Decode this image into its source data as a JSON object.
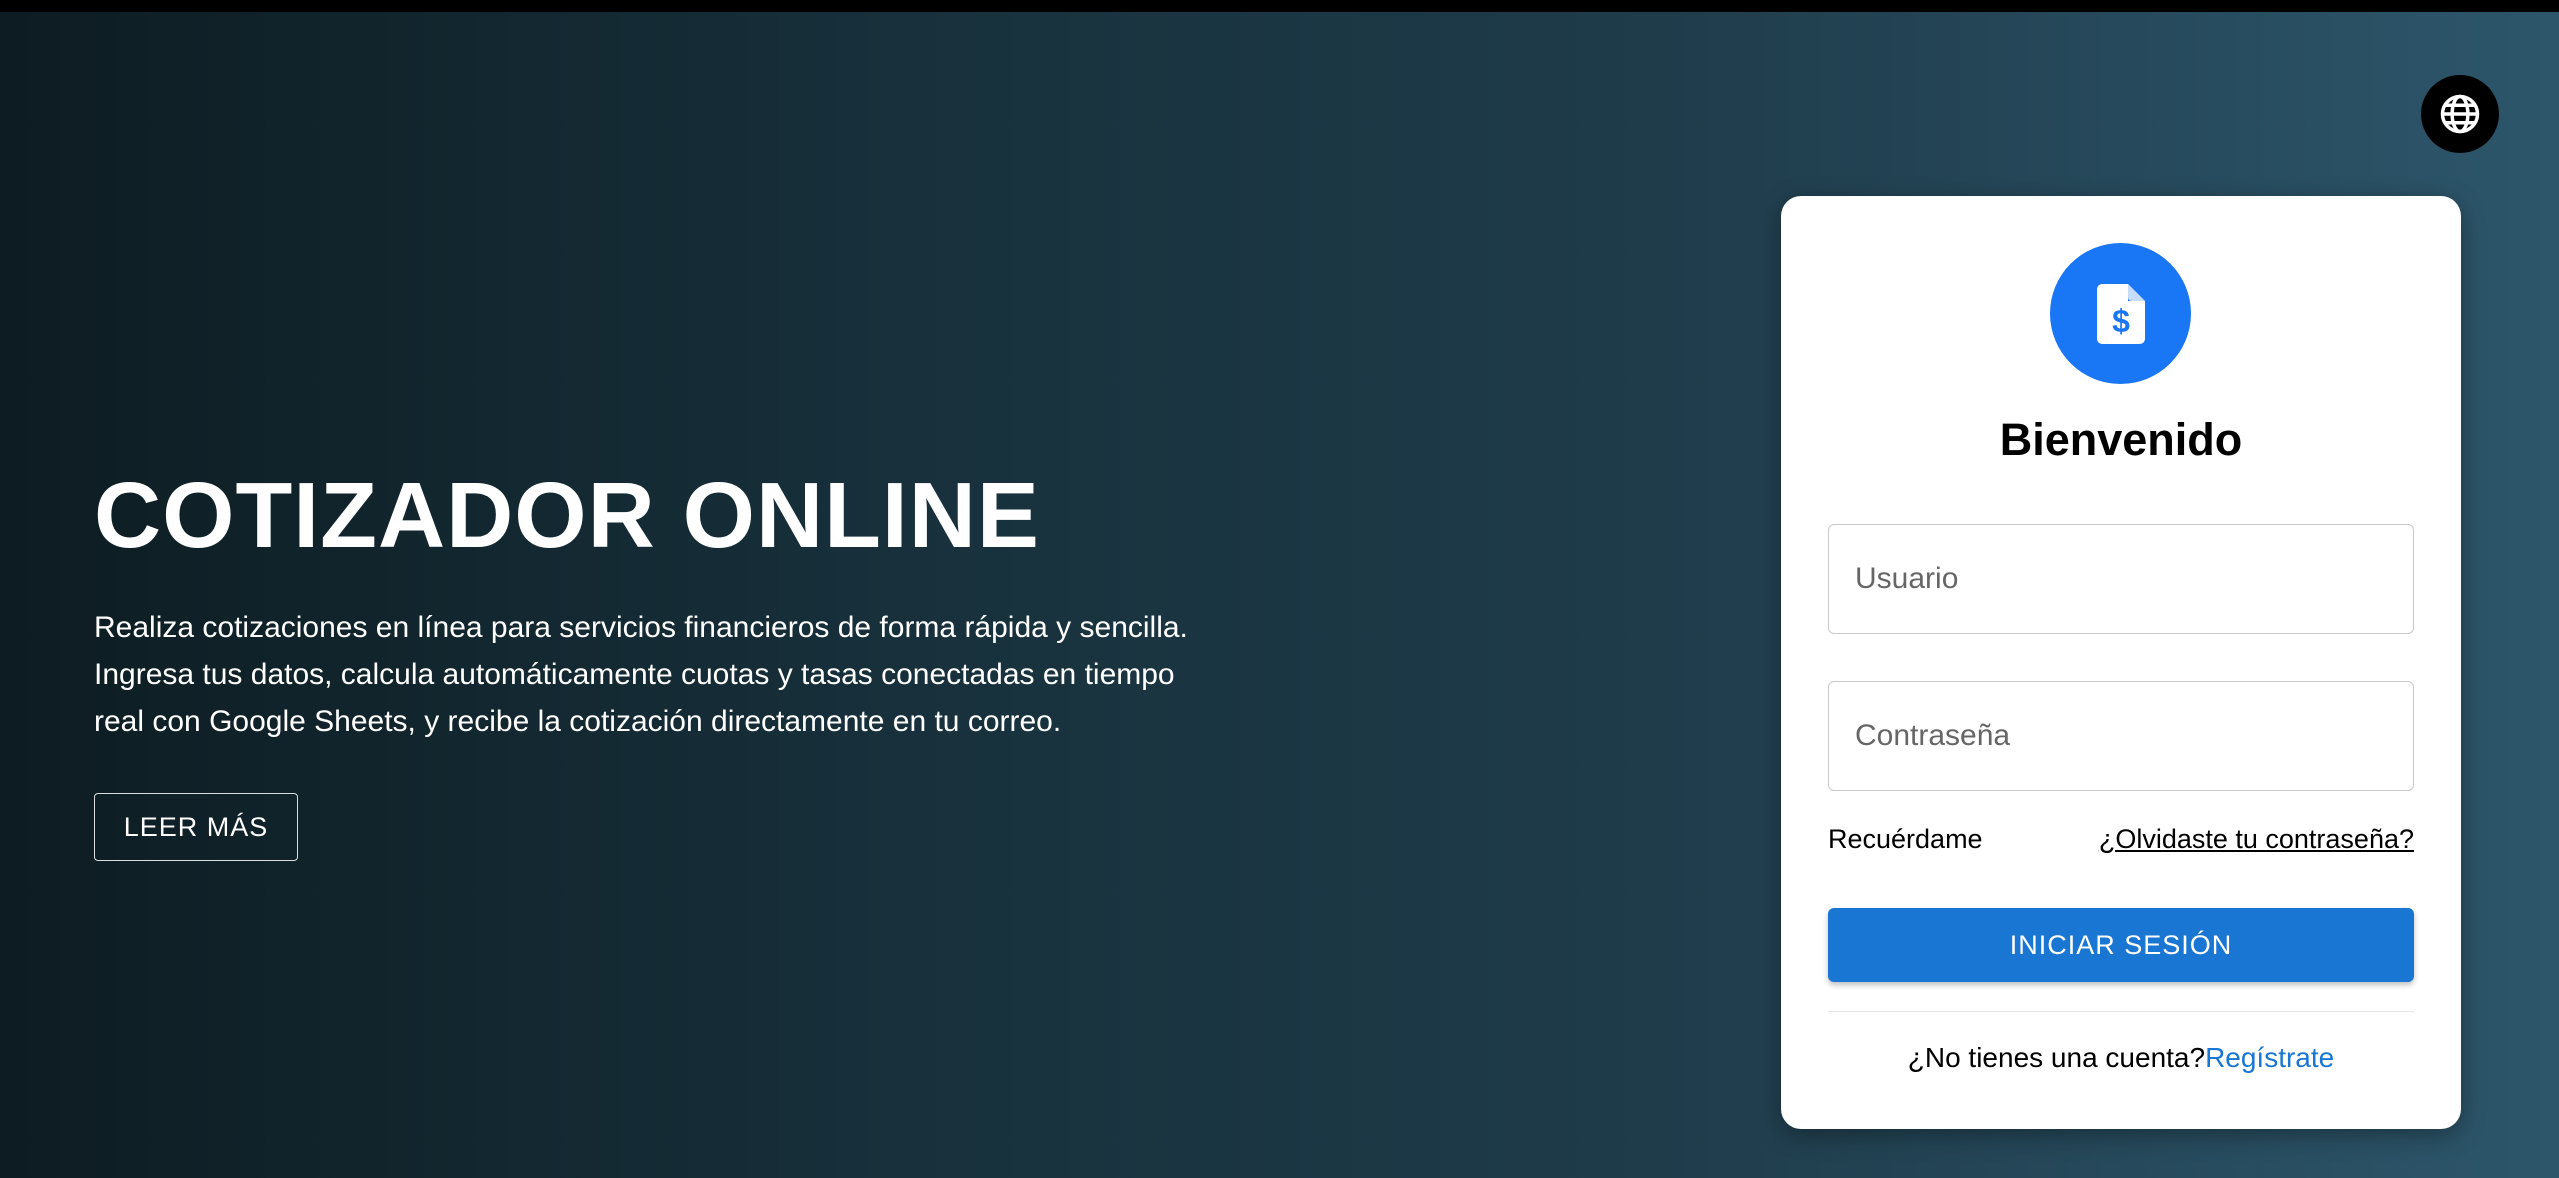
{
  "hero": {
    "title": "COTIZADOR ONLINE",
    "description_line1": "Realiza cotizaciones en línea para servicios financieros de forma rápida y sencilla.",
    "description_line2": "Ingresa tus datos, calcula automáticamente cuotas y tasas conectadas en tiempo",
    "description_line3": "real con Google Sheets, y recibe la cotización directamente en tu correo.",
    "read_more_label": "LEER MÁS"
  },
  "language_button": {
    "icon": "globe-icon"
  },
  "login": {
    "avatar_icon": "invoice-dollar-icon",
    "title": "Bienvenido",
    "username_placeholder": "Usuario",
    "password_placeholder": "Contraseña",
    "remember_label": "Recuérdame",
    "forgot_label": "¿Olvidaste tu contraseña?",
    "submit_label": "INICIAR SESIÓN",
    "signup_prompt": "¿No tienes una cuenta?",
    "signup_link": "Regístrate"
  },
  "colors": {
    "accent": "#1976d2",
    "avatar_bg": "#1976f5",
    "background_dark": "#0d1c22",
    "background_light": "#2d566b"
  }
}
